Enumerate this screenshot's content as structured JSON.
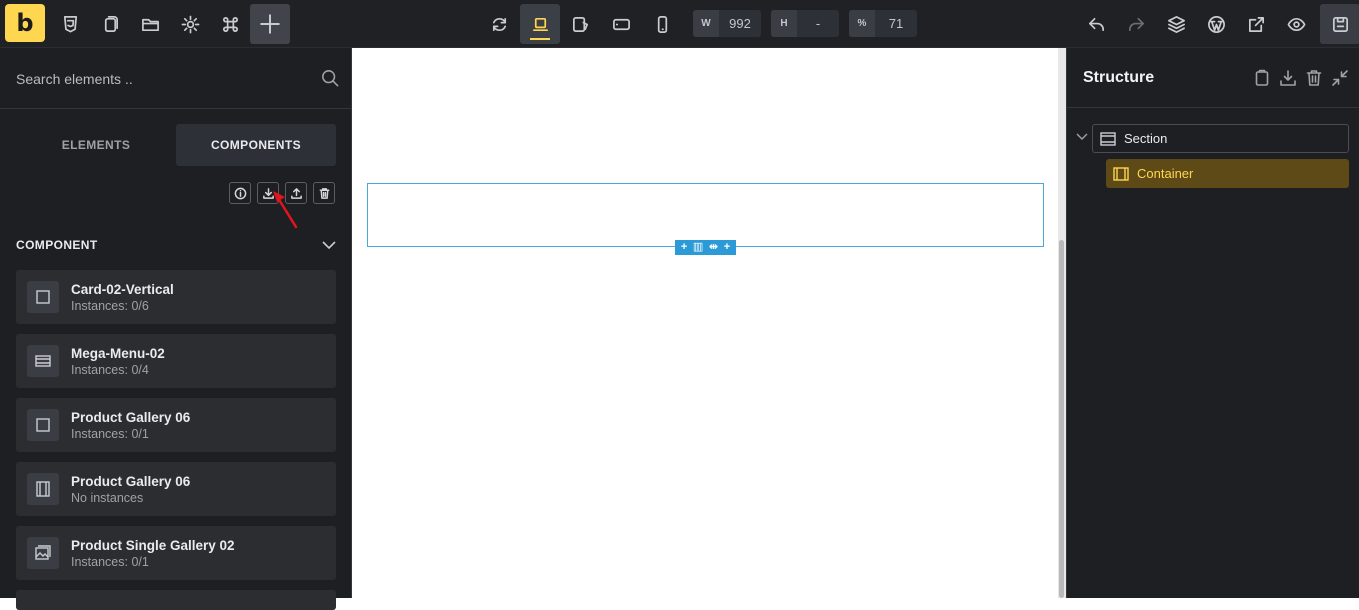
{
  "app": {
    "logo_letter": "b",
    "accent": "#ffd64f"
  },
  "topbar": {
    "left_tools": [
      "css3-icon",
      "pages-icon",
      "folder-icon",
      "settings-icon",
      "command-icon",
      "add-icon"
    ],
    "device_tools": [
      "refresh-icon",
      "laptop-icon",
      "tablet-landscape-icon",
      "tablet-icon",
      "mobile-icon"
    ],
    "width": {
      "label": "W",
      "value": "992"
    },
    "height": {
      "label": "H",
      "value": "-"
    },
    "zoom": {
      "label": "%",
      "value": "71"
    },
    "right_tools": [
      "undo-icon",
      "redo-icon",
      "layers-icon",
      "wordpress-icon",
      "external-link-icon",
      "preview-icon",
      "save-icon"
    ]
  },
  "sidebar": {
    "search_placeholder": "Search elements ..",
    "tabs": [
      {
        "label": "ELEMENTS",
        "active": false
      },
      {
        "label": "COMPONENTS",
        "active": true
      }
    ],
    "tools": [
      "info-icon",
      "import-icon",
      "export-icon",
      "delete-icon"
    ],
    "section_title": "COMPONENT",
    "components": [
      {
        "name": "Card-02-Vertical",
        "instances": "Instances: 0/6",
        "icon": "square-icon"
      },
      {
        "name": "Mega-Menu-02",
        "instances": "Instances: 0/4",
        "icon": "section-icon"
      },
      {
        "name": "Product Gallery 06",
        "instances": "Instances: 0/1",
        "icon": "square-icon"
      },
      {
        "name": "Product Gallery 06",
        "instances": "No instances",
        "icon": "container-icon"
      },
      {
        "name": "Product Single Gallery 02",
        "instances": "Instances: 0/1",
        "icon": "gallery-icon"
      }
    ]
  },
  "canvas": {
    "container_controls": [
      "+",
      "▥",
      "⇹",
      "+"
    ]
  },
  "structure": {
    "title": "Structure",
    "tools": [
      "clipboard-icon",
      "download-icon",
      "trash-icon",
      "collapse-icon"
    ],
    "nodes": [
      {
        "label": "Section",
        "icon": "section-icon"
      },
      {
        "label": "Container",
        "icon": "container-icon"
      }
    ]
  }
}
